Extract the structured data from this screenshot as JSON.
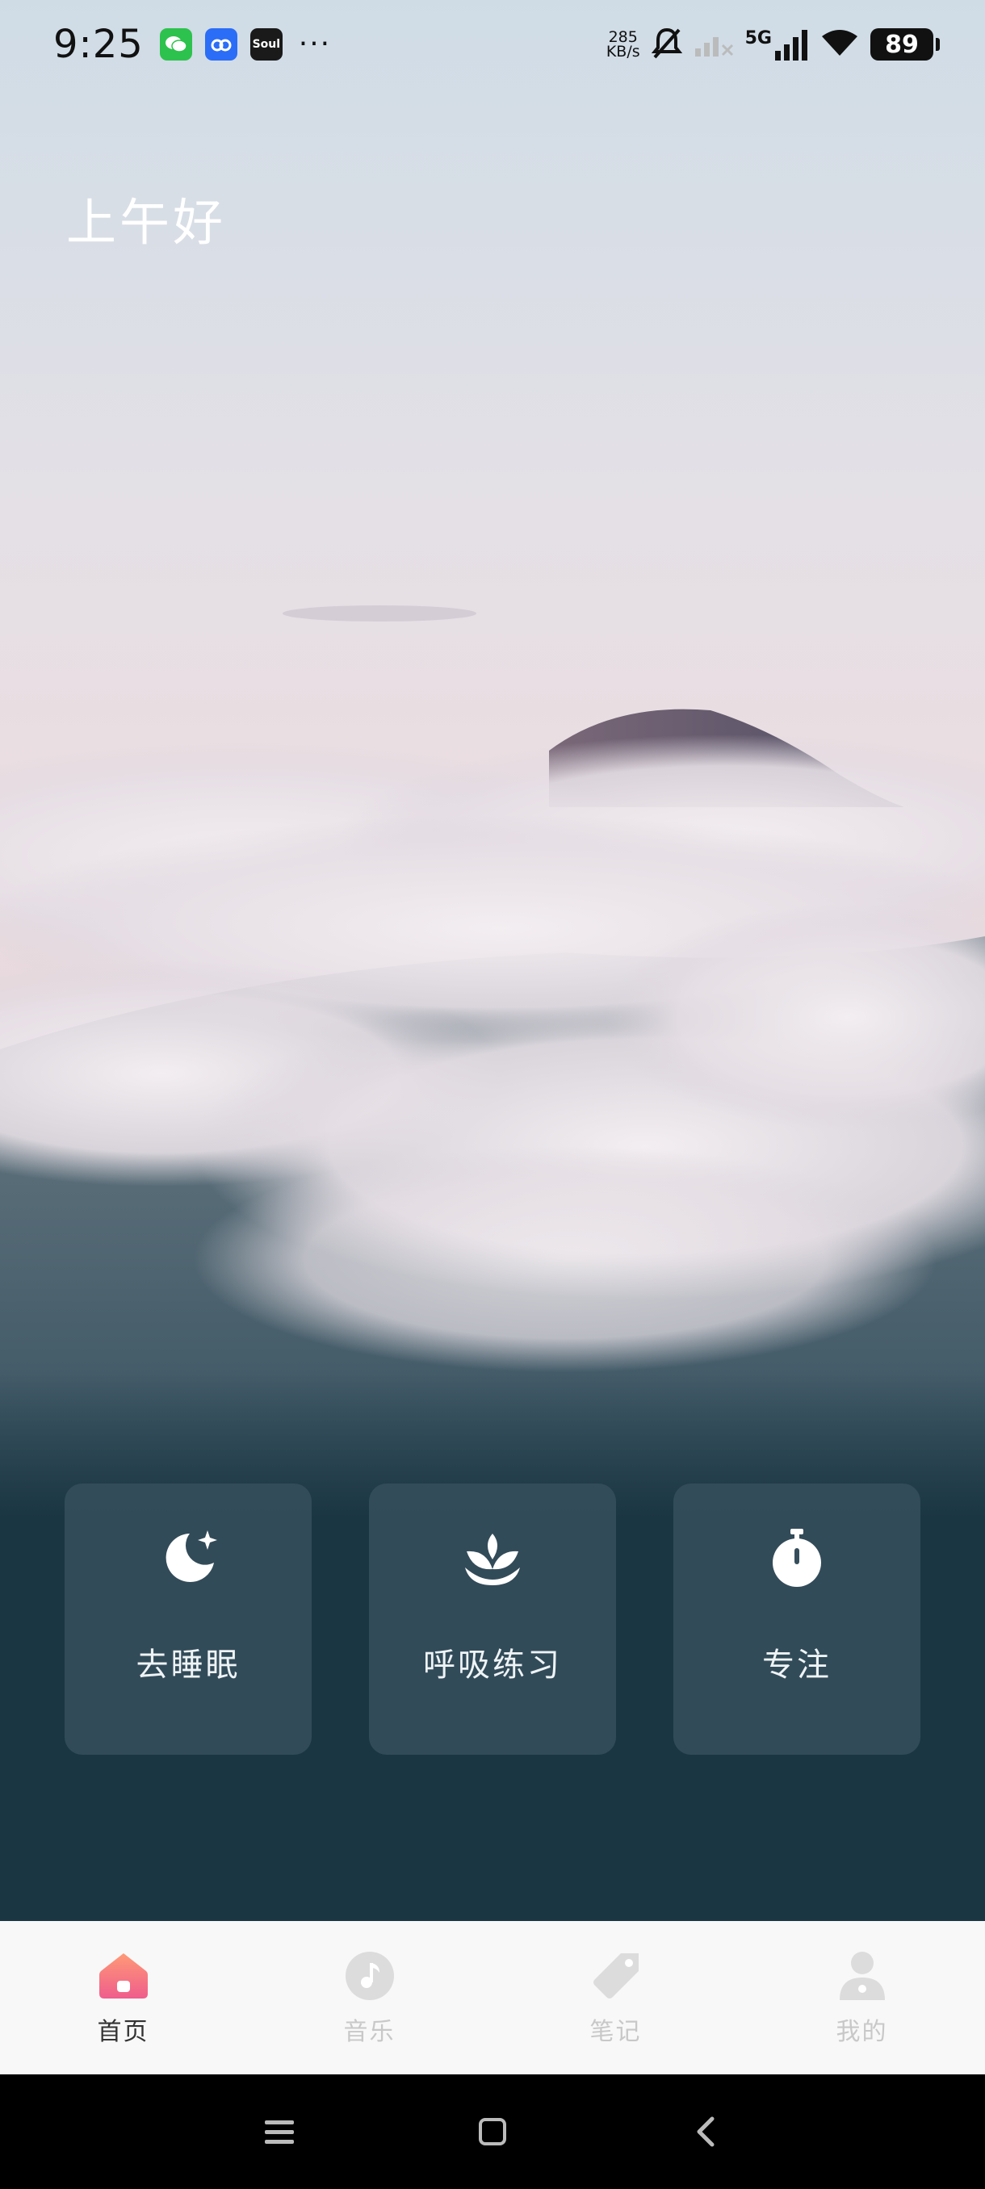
{
  "status_bar": {
    "time": "9:25",
    "net_speed_value": "285",
    "net_speed_unit": "KB/s",
    "network_type": "5G",
    "battery": "89",
    "apps": [
      "wechat-icon",
      "baidu-netdisk-icon",
      "soul-icon"
    ],
    "soul_label": "Soul",
    "more": "···"
  },
  "greeting": "上午好",
  "cards": [
    {
      "label": "去睡眠",
      "icon": "moon-star-icon"
    },
    {
      "label": "呼吸练习",
      "icon": "lotus-icon"
    },
    {
      "label": "专注",
      "icon": "stopwatch-icon"
    }
  ],
  "bottom_nav": [
    {
      "label": "首页",
      "icon": "home-icon",
      "active": true
    },
    {
      "label": "音乐",
      "icon": "music-icon",
      "active": false
    },
    {
      "label": "笔记",
      "icon": "tag-icon",
      "active": false
    },
    {
      "label": "我的",
      "icon": "user-icon",
      "active": false
    }
  ],
  "colors": {
    "accent_home": "#f06a86",
    "inactive_nav": "#dcdcdc",
    "panel_bg": "#1b3643",
    "card_bg": "#364e5c"
  }
}
